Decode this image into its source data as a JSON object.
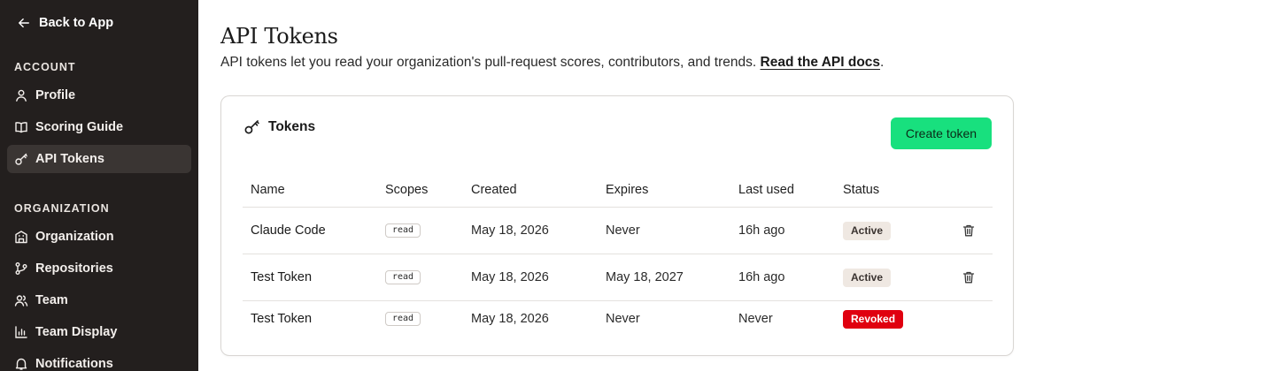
{
  "sidebar": {
    "back_label": "Back to App",
    "sections": [
      {
        "label": "ACCOUNT"
      },
      {
        "label": "ORGANIZATION"
      }
    ],
    "items": [
      {
        "label": "Profile",
        "icon": "user-icon",
        "active": false
      },
      {
        "label": "Scoring Guide",
        "icon": "book-icon",
        "active": false
      },
      {
        "label": "API Tokens",
        "icon": "key-icon",
        "active": true
      },
      {
        "label": "Organization",
        "icon": "building-icon",
        "active": false
      },
      {
        "label": "Repositories",
        "icon": "git-branch-icon",
        "active": false
      },
      {
        "label": "Team",
        "icon": "users-icon",
        "active": false
      },
      {
        "label": "Team Display",
        "icon": "bar-chart-icon",
        "active": false
      },
      {
        "label": "Notifications",
        "icon": "bell-icon",
        "active": false
      }
    ]
  },
  "main": {
    "title": "API Tokens",
    "description": "API tokens let you read your organization's pull-request scores, contributors, and trends.",
    "docs_link": "Read the API docs",
    "description_end": "."
  },
  "card": {
    "title": "Tokens",
    "create_label": "Create token",
    "columns": [
      "Name",
      "Scopes",
      "Created",
      "Expires",
      "Last used",
      "Status"
    ],
    "rows": [
      {
        "name": "Claude Code",
        "scope": "read",
        "created": "May 18, 2026",
        "expires": "Never",
        "last_used": "16h ago",
        "status": "Active"
      },
      {
        "name": "Test Token",
        "scope": "read",
        "created": "May 18, 2026",
        "expires": "May 18, 2027",
        "last_used": "16h ago",
        "status": "Active"
      },
      {
        "name": "Test Token",
        "scope": "read",
        "created": "May 18, 2026",
        "expires": "Never",
        "last_used": "Never",
        "status": "Revoked"
      }
    ]
  },
  "colors": {
    "sidebar_bg": "#231f1e",
    "active_item_bg": "#3a3533",
    "accent": "#18e07e",
    "active_badge": "#efe8e2",
    "revoked_badge": "#e0000f"
  }
}
